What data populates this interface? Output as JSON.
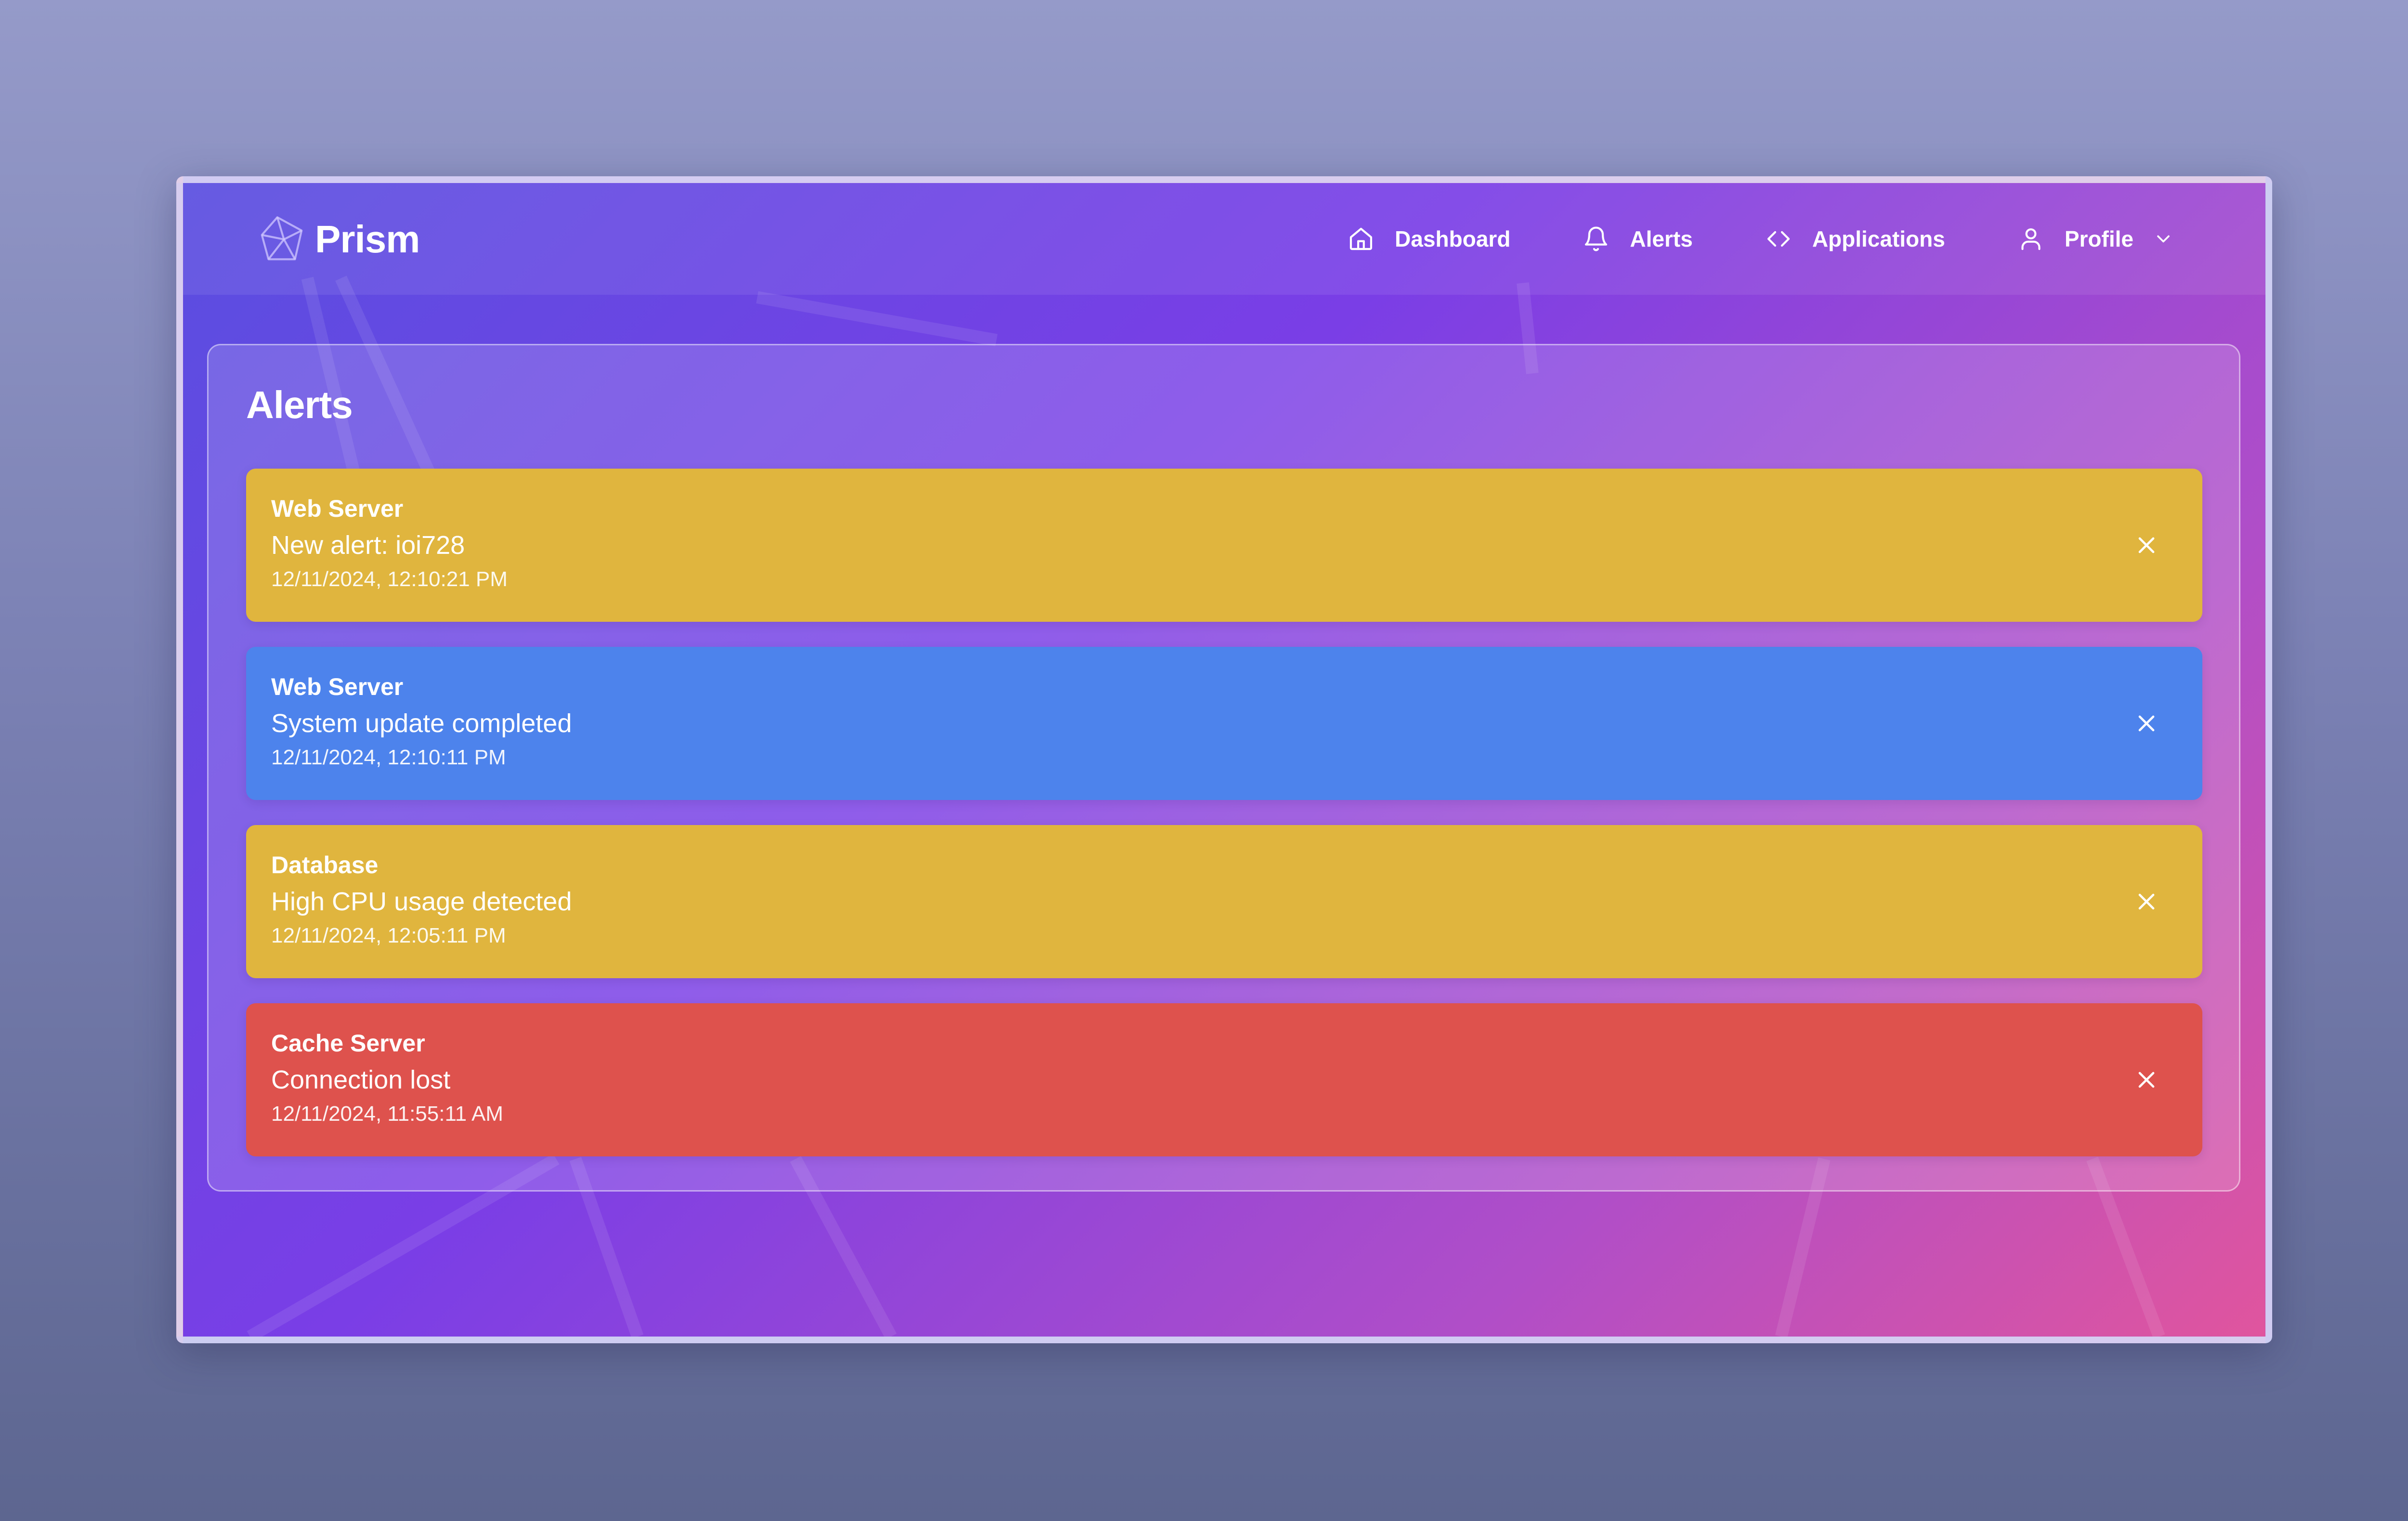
{
  "app": {
    "name": "Prism"
  },
  "nav": {
    "dashboard": "Dashboard",
    "alerts": "Alerts",
    "applications": "Applications",
    "profile": "Profile"
  },
  "page": {
    "title": "Alerts"
  },
  "alerts": [
    {
      "source": "Web Server",
      "message": "New alert: ioi728",
      "time": "12/11/2024, 12:10:21 PM",
      "severity": "warning",
      "color": "#e0b53e"
    },
    {
      "source": "Web Server",
      "message": "System update completed",
      "time": "12/11/2024, 12:10:11 PM",
      "severity": "info",
      "color": "#4d83ec"
    },
    {
      "source": "Database",
      "message": "High CPU usage detected",
      "time": "12/11/2024, 12:05:11 PM",
      "severity": "warning",
      "color": "#e0b53e"
    },
    {
      "source": "Cache Server",
      "message": "Connection lost",
      "time": "12/11/2024, 11:55:11 AM",
      "severity": "error",
      "color": "#de524d"
    }
  ],
  "icons": {
    "brand": "prism-logo-icon",
    "dashboard": "home-icon",
    "alerts": "bell-icon",
    "applications": "code-icon",
    "profile": "user-icon",
    "profile_menu": "chevron-down-icon",
    "dismiss": "close-icon"
  }
}
